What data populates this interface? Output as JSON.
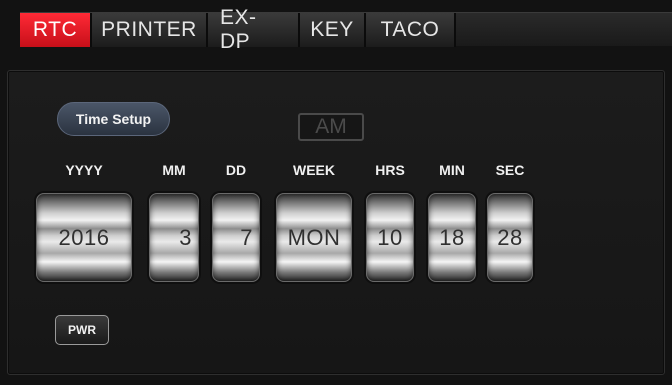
{
  "tabs": [
    {
      "label": "RTC",
      "active": true
    },
    {
      "label": "PRINTER",
      "active": false
    },
    {
      "label": "EX-DP",
      "active": false
    },
    {
      "label": "KEY",
      "active": false
    },
    {
      "label": "TACO",
      "active": false
    }
  ],
  "time_setup": {
    "label": "Time Setup"
  },
  "ampm": {
    "value": "AM"
  },
  "fields": {
    "year": {
      "label": "YYYY",
      "value": "2016"
    },
    "month": {
      "label": "MM",
      "value": "3"
    },
    "day": {
      "label": "DD",
      "value": "7"
    },
    "week": {
      "label": "WEEK",
      "value": "MON"
    },
    "hours": {
      "label": "HRS",
      "value": "10"
    },
    "min": {
      "label": "MIN",
      "value": "18"
    },
    "sec": {
      "label": "SEC",
      "value": "28"
    }
  },
  "power": {
    "label": "PWR"
  },
  "colors": {
    "active_tab": "#e01a24",
    "background": "#121212",
    "time_setup_button": "#3a4453"
  }
}
